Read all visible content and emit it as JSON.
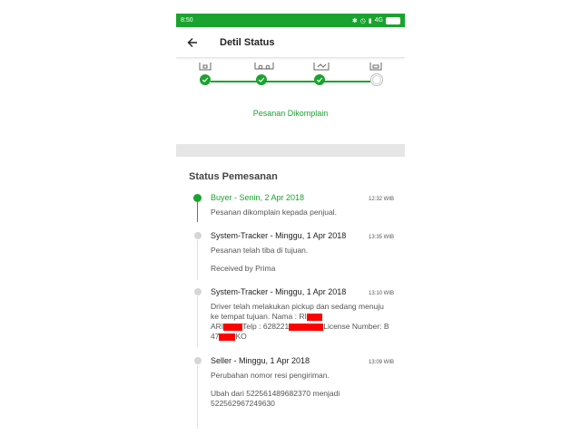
{
  "status_bar": {
    "time": "8:50",
    "network": "4G"
  },
  "header": {
    "title": "Detil Status"
  },
  "progress": {
    "steps": [
      {
        "icon": "order-icon",
        "done": true
      },
      {
        "icon": "truck-icon",
        "done": true
      },
      {
        "icon": "handover-icon",
        "done": true
      },
      {
        "icon": "received-icon",
        "done": false
      }
    ],
    "status_label": "Pesanan Dikomplain"
  },
  "section": {
    "title": "Status Pemesanan"
  },
  "entries": [
    {
      "title": "Buyer - Senin, 2 Apr 2018",
      "time": "12:32 WIB",
      "active": true,
      "lines": [
        "Pesanan dikomplain kepada penjual."
      ]
    },
    {
      "title": "System-Tracker - Minggu, 1 Apr 2018",
      "time": "13:35 WIB",
      "active": false,
      "lines": [
        "Pesanan telah tiba di tujuan.",
        "Received by Prima"
      ]
    },
    {
      "title": "System-Tracker - Minggu, 1 Apr 2018",
      "time": "13:10 WIB",
      "active": false,
      "lines": [
        "Driver telah melakukan pickup dan sedang menuju ke tempat tujuan. Nama : RI",
        "ARI",
        "Telp : 628221",
        "License Number: B 47",
        "KO"
      ]
    },
    {
      "title": "Seller - Minggu, 1 Apr 2018",
      "time": "13:09 WIB",
      "active": false,
      "lines": [
        "Perubahan nomor resi pengiriman.",
        "Ubah dari 522561489682370 menjadi 522562967249630"
      ]
    }
  ],
  "colors": {
    "accent": "#1aa32e",
    "divider": "#e6e6e6",
    "redaction": "#ff0000"
  }
}
